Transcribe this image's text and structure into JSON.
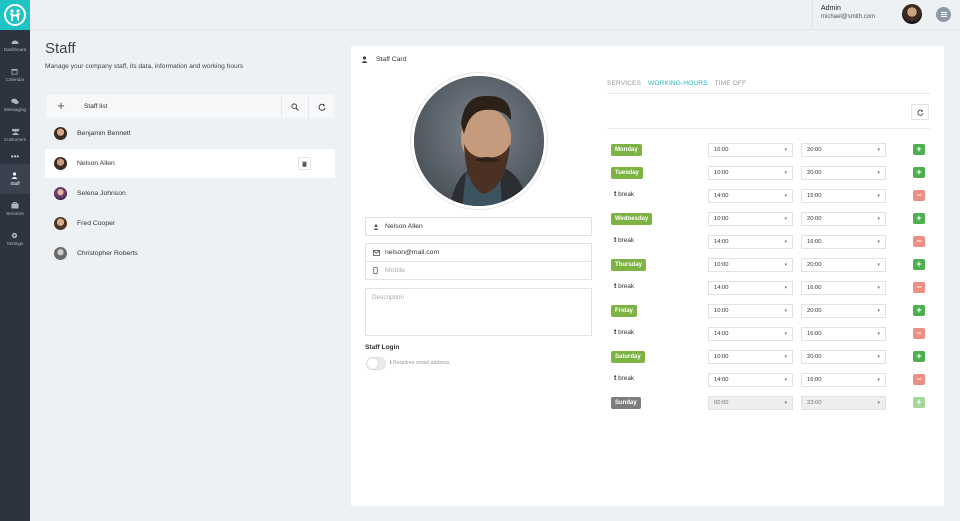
{
  "nav": [
    {
      "label": "Dashboard",
      "icon": "dashboard-icon"
    },
    {
      "label": "Calendar",
      "icon": "calendar-icon"
    },
    {
      "label": "Messaging",
      "icon": "messaging-icon"
    },
    {
      "label": "Customers",
      "icon": "customers-icon"
    },
    {
      "label": "•••",
      "icon": "more-icon"
    },
    {
      "label": "Staff",
      "icon": "staff-icon",
      "active": true
    },
    {
      "label": "Services",
      "icon": "services-icon"
    },
    {
      "label": "Settings",
      "icon": "settings-icon"
    }
  ],
  "header": {
    "user_name": "Admin",
    "user_email": "michael@smith.com"
  },
  "page": {
    "title": "Staff",
    "subtitle": "Manage your company staff, its data, information and working hours"
  },
  "staff_list": {
    "title": "Staff list",
    "items": [
      {
        "name": "Benjamin Bennett"
      },
      {
        "name": "Nelson Allen",
        "selected": true
      },
      {
        "name": "Selena Johnson"
      },
      {
        "name": "Fred Cooper"
      },
      {
        "name": "Christopher Roberts"
      }
    ]
  },
  "card": {
    "title": "Staff Card",
    "name": "Nelson Allen",
    "email": "nelson@mail.com",
    "mobile_placeholder": "Mobile",
    "description_placeholder": "Description",
    "login_title": "Staff Login",
    "login_note": "Requires email address"
  },
  "tabs": [
    {
      "label": "SERVICES",
      "active": false
    },
    {
      "label": "WORKING-HOURS",
      "active": true
    },
    {
      "label": "TIME OFF",
      "active": false
    }
  ],
  "colors": {
    "accent": "#1fc3c6",
    "day_badge": "#7cb342",
    "add_btn": "#4caf50",
    "remove_btn": "#ef8e82"
  },
  "hours": [
    {
      "type": "day",
      "label": "Monday",
      "from": "16:00",
      "to": "20:00",
      "action": "+"
    },
    {
      "type": "day",
      "label": "Tuesday",
      "from": "10:00",
      "to": "20:00",
      "action": "+"
    },
    {
      "type": "break",
      "label": "break",
      "from": "14:00",
      "to": "15:00",
      "action": "−"
    },
    {
      "type": "day",
      "label": "Wednesday",
      "from": "10:00",
      "to": "20:00",
      "action": "+"
    },
    {
      "type": "break",
      "label": "break",
      "from": "14:00",
      "to": "16:00",
      "action": "−"
    },
    {
      "type": "day",
      "label": "Thursday",
      "from": "10:00",
      "to": "20:00",
      "action": "+"
    },
    {
      "type": "break",
      "label": "break",
      "from": "14:00",
      "to": "16:00",
      "action": "−"
    },
    {
      "type": "day",
      "label": "Friday",
      "from": "10:00",
      "to": "20:00",
      "action": "+"
    },
    {
      "type": "break",
      "label": "break",
      "from": "14:00",
      "to": "16:00",
      "action": "−"
    },
    {
      "type": "day",
      "label": "Saturday",
      "from": "10:00",
      "to": "20:00",
      "action": "+"
    },
    {
      "type": "break",
      "label": "break",
      "from": "14:00",
      "to": "16:00",
      "action": "−"
    },
    {
      "type": "off",
      "label": "Sunday",
      "from": "00:00",
      "to": "23:00",
      "action": "+"
    }
  ]
}
